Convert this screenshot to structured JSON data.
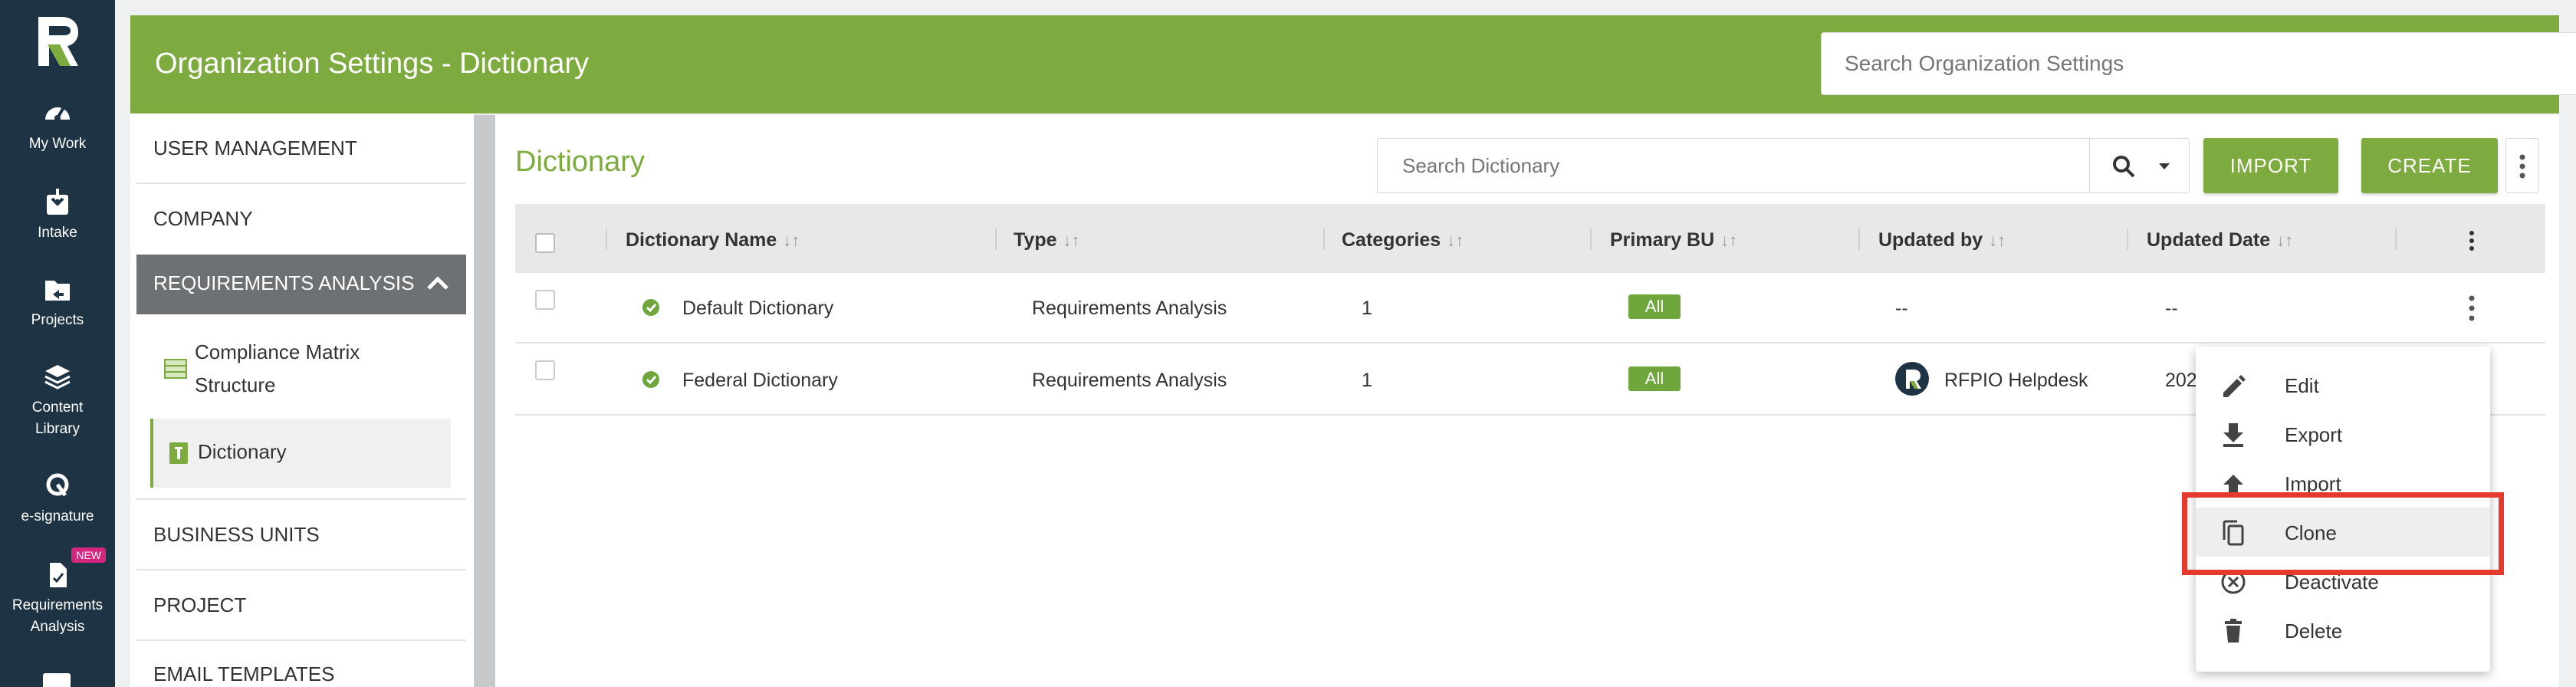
{
  "rail": {
    "items": [
      {
        "label": "My Work",
        "icon": "speedometer-icon"
      },
      {
        "label": "Intake",
        "icon": "inbox-download-icon"
      },
      {
        "label": "Projects",
        "icon": "folder-icon"
      },
      {
        "label": "Content Library",
        "line1": "Content",
        "line2": "Library",
        "icon": "layers-icon"
      },
      {
        "label": "e-signature",
        "icon": "signature-icon"
      },
      {
        "label": "Requirements Analysis",
        "line1": "Requirements",
        "line2": "Analysis",
        "icon": "document-icon",
        "badge": "NEW"
      }
    ]
  },
  "header": {
    "title": "Organization Settings - Dictionary",
    "search_placeholder": "Search Organization Settings",
    "color": "#7eab3f"
  },
  "nav": {
    "items": [
      "USER MANAGEMENT",
      "COMPANY",
      "REQUIREMENTS ANALYSIS",
      "BUSINESS UNITS",
      "PROJECT",
      "EMAIL TEMPLATES"
    ],
    "sub_items": [
      {
        "label1": "Compliance Matrix",
        "label2": "Structure"
      },
      {
        "label": "Dictionary"
      }
    ]
  },
  "content": {
    "title": "Dictionary",
    "search_placeholder": "Search Dictionary",
    "import_label": "IMPORT",
    "create_label": "CREATE"
  },
  "table": {
    "columns": [
      "Dictionary Name",
      "Type",
      "Categories",
      "Primary BU",
      "Updated by",
      "Updated Date"
    ],
    "sort_glyph": "↓↑",
    "rows": [
      {
        "name": "Default Dictionary",
        "type": "Requirements Analysis",
        "categories": "1",
        "primary_bu": "All",
        "updated_by": "--",
        "updated_date": "--"
      },
      {
        "name": "Federal Dictionary",
        "type": "Requirements Analysis",
        "categories": "1",
        "primary_bu": "All",
        "updated_by": "RFPIO Helpdesk",
        "updated_date": "202"
      }
    ]
  },
  "menu": {
    "items": [
      {
        "label": "Edit",
        "icon": "pencil-icon"
      },
      {
        "label": "Export",
        "icon": "download-icon"
      },
      {
        "label": "Import",
        "icon": "upload-icon"
      },
      {
        "label": "Clone",
        "icon": "copy-icon"
      },
      {
        "label": "Deactivate",
        "icon": "circle-x-icon"
      },
      {
        "label": "Delete",
        "icon": "trash-icon"
      }
    ],
    "highlighted": "Clone",
    "highlight_color": "#e53b2c"
  }
}
